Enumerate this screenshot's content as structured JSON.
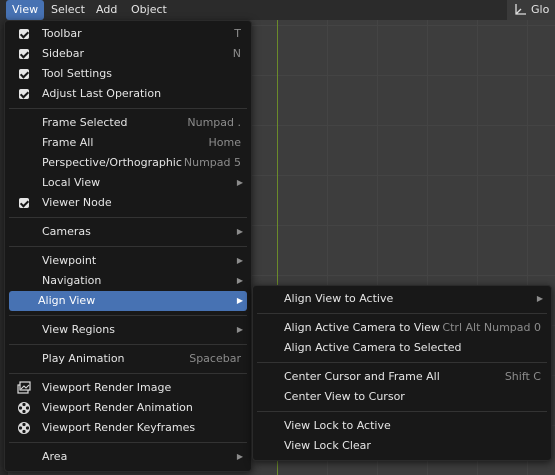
{
  "topbar": {
    "menus": [
      "View",
      "Select",
      "Add",
      "Object"
    ],
    "right_label": "Glo"
  },
  "view_menu": {
    "items": [
      {
        "label": "Toolbar",
        "shortcut": "T",
        "checked": true
      },
      {
        "label": "Sidebar",
        "shortcut": "N",
        "checked": true
      },
      {
        "label": "Tool Settings",
        "shortcut": "",
        "checked": true
      },
      {
        "label": "Adjust Last Operation",
        "shortcut": "",
        "checked": true
      },
      {
        "label": "Frame Selected",
        "shortcut": "Numpad ."
      },
      {
        "label": "Frame All",
        "shortcut": "Home"
      },
      {
        "label": "Perspective/Orthographic",
        "shortcut": "Numpad 5"
      },
      {
        "label": "Local View",
        "submenu": true
      },
      {
        "label": "Viewer Node",
        "checked": true
      },
      {
        "label": "Cameras",
        "submenu": true
      },
      {
        "label": "Viewpoint",
        "submenu": true
      },
      {
        "label": "Navigation",
        "submenu": true
      },
      {
        "label": "Align View",
        "submenu": true,
        "highlighted": true
      },
      {
        "label": "View Regions",
        "submenu": true
      },
      {
        "label": "Play Animation",
        "shortcut": "Spacebar"
      },
      {
        "label": "Viewport Render Image",
        "icon": "render-image-icon"
      },
      {
        "label": "Viewport Render Animation",
        "icon": "render-animation-icon"
      },
      {
        "label": "Viewport Render Keyframes",
        "icon": "render-keyframes-icon"
      },
      {
        "label": "Area",
        "submenu": true
      }
    ]
  },
  "align_submenu": {
    "items": [
      {
        "label": "Align View to Active",
        "submenu": true
      },
      {
        "label": "Align Active Camera to View",
        "shortcut": "Ctrl Alt Numpad 0"
      },
      {
        "label": "Align Active Camera to Selected",
        "shortcut": ""
      },
      {
        "label": "Center Cursor and Frame All",
        "shortcut": "Shift C"
      },
      {
        "label": "Center View to Cursor",
        "shortcut": ""
      },
      {
        "label": "View Lock to Active",
        "shortcut": ""
      },
      {
        "label": "View Lock Clear",
        "shortcut": ""
      }
    ]
  },
  "colors": {
    "highlight": "#4772b3",
    "menu_bg": "#181818",
    "viewport_bg": "#3d3d3d",
    "axis_green": "#6b8a2a"
  }
}
